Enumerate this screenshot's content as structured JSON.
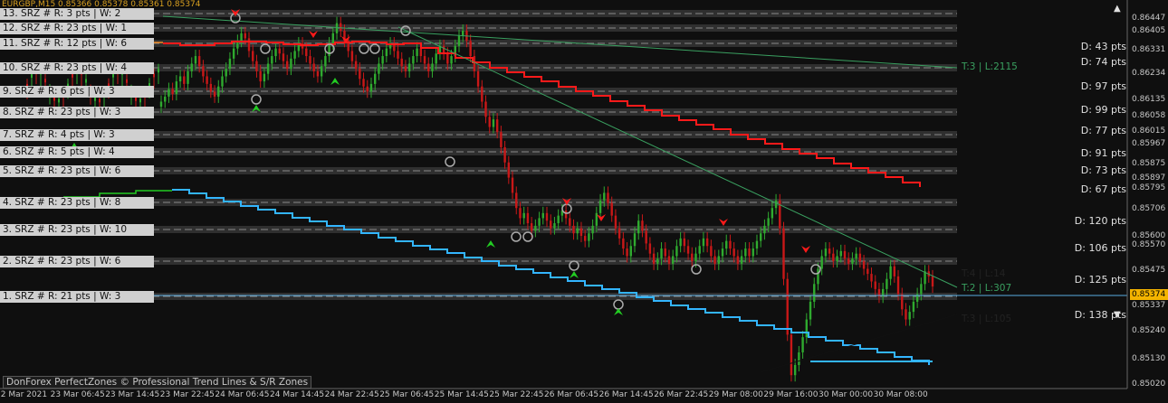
{
  "header": {
    "symbol_text": "EURGBP,M15  0.85366 0.85378 0.85361 0.85374"
  },
  "colors": {
    "background": "#0f0f0f",
    "bull": "#2faa2f",
    "bear": "#c81818",
    "resistance": "#ff1a1a",
    "support": "#33b5ff",
    "orange": "#f08a24",
    "green_band": "#22cc22",
    "zone": "#4a4a4a",
    "price_line": "#5aaee0",
    "current_price_bg": "#f4b400"
  },
  "zones": [
    {
      "label": "13. SRZ # R: 3 pts | W: 2",
      "distance": "",
      "price": 0.8644
    },
    {
      "label": "12. SRZ # R: 23 pts | W: 1",
      "distance": "D: 43 pts",
      "price": 0.864
    },
    {
      "label": "11. SRZ # R: 12 pts | W: 6",
      "distance": "D: 74 pts",
      "price": 0.8633
    },
    {
      "label": "10. SRZ # R: 23 pts | W: 4",
      "distance": "D: 97 pts",
      "price": 0.8623
    },
    {
      "label": "9. SRZ # R: 6 pts | W: 3",
      "distance": "D: 99 pts",
      "price": 0.8613
    },
    {
      "label": "8. SRZ # R: 23 pts | W: 3",
      "distance": "D: 77 pts",
      "price": 0.8606
    },
    {
      "label": "7. SRZ # R: 4 pts | W: 3",
      "distance": "D: 91 pts",
      "price": 0.8597
    },
    {
      "label": "6. SRZ # R: 5 pts | W: 4",
      "distance": "D: 73 pts",
      "price": 0.8589
    },
    {
      "label": "5. SRZ # R: 23 pts | W: 6",
      "distance": "D: 67 pts",
      "price": 0.8582
    },
    {
      "label": "4. SRZ # R: 23 pts | W: 8",
      "distance": "D: 120 pts",
      "price": 0.857
    },
    {
      "label": "3. SRZ # R: 23 pts | W: 10",
      "distance": "D: 106 pts",
      "price": 0.8558
    },
    {
      "label": "2. SRZ # R: 23 pts | W: 6",
      "distance": "D: 125 pts",
      "price": 0.8545
    },
    {
      "label": "1. SRZ # R: 21 pts | W: 3",
      "distance": "D: 138 pts",
      "price": 0.8534
    }
  ],
  "trendline_labels": [
    {
      "text": "T:3 | L:2115",
      "color": "#3aa060"
    },
    {
      "text": "T:4 | L:14",
      "color": "#222222"
    },
    {
      "text": "T:2 | L:307",
      "color": "#3aa060"
    },
    {
      "text": "T:3 | L:105",
      "color": "#222222"
    }
  ],
  "footer": "DonForex PerfectZones © Professional Trend Lines & S/R Zones",
  "current_price": "0.85374",
  "chart_data": {
    "type": "candlestick",
    "title": "EURGBP,M15",
    "ylim": [
      0.8501,
      0.8648
    ],
    "x_ticks": [
      "22 Mar 2021",
      "23 Mar 06:45",
      "23 Mar 14:45",
      "23 Mar 22:45",
      "24 Mar 06:45",
      "24 Mar 14:45",
      "24 Mar 22:45",
      "25 Mar 06:45",
      "25 Mar 14:45",
      "25 Mar 22:45",
      "26 Mar 06:45",
      "26 Mar 14:45",
      "26 Mar 22:45",
      "29 Mar 08:00",
      "29 Mar 16:00",
      "30 Mar 00:00",
      "30 Mar 08:00"
    ],
    "y_ticks": [
      "0.86447",
      "0.86405",
      "0.86331",
      "0.86234",
      "0.86135",
      "0.86058",
      "0.86015",
      "0.85967",
      "0.85875",
      "0.85897",
      "0.85795",
      "0.85706",
      "0.85600",
      "0.85570",
      "0.85475",
      "0.85337",
      "0.85240",
      "0.85130",
      "0.85020"
    ],
    "close": [
      0.861,
      0.8612,
      0.8615,
      0.8613,
      0.8618,
      0.862,
      0.8617,
      0.8622,
      0.8625,
      0.8628,
      0.8624,
      0.862,
      0.8617,
      0.8614,
      0.8612,
      0.8616,
      0.862,
      0.8623,
      0.8627,
      0.8631,
      0.8634,
      0.8637,
      0.8635,
      0.863,
      0.8626,
      0.8622,
      0.8618,
      0.8621,
      0.8625,
      0.8628,
      0.8631,
      0.8629,
      0.8626,
      0.8623,
      0.8627,
      0.863,
      0.8633,
      0.8631,
      0.8628,
      0.8625,
      0.8622,
      0.862,
      0.8624,
      0.8628,
      0.8633,
      0.8637,
      0.8641,
      0.8638,
      0.8634,
      0.863,
      0.8626,
      0.8623,
      0.8619,
      0.8616,
      0.8614,
      0.8617,
      0.8621,
      0.8625,
      0.8628,
      0.8631,
      0.8633,
      0.863,
      0.8627,
      0.8624,
      0.8622,
      0.8625,
      0.8628,
      0.8631,
      0.8628,
      0.8625,
      0.8622,
      0.8625,
      0.8629,
      0.8632,
      0.8629,
      0.8625,
      0.8628,
      0.8632,
      0.8636,
      0.8638,
      0.8634,
      0.8628,
      0.8622,
      0.8616,
      0.861,
      0.8604,
      0.86,
      0.8603,
      0.8598,
      0.8592,
      0.8586,
      0.858,
      0.8574,
      0.8568,
      0.8564,
      0.8566,
      0.8562,
      0.8559,
      0.8561,
      0.8564,
      0.8566,
      0.8563,
      0.856,
      0.8562,
      0.8565,
      0.8567,
      0.8564,
      0.8561,
      0.8558,
      0.856,
      0.8557,
      0.8555,
      0.8558,
      0.8561,
      0.8566,
      0.8571,
      0.8574,
      0.857,
      0.8565,
      0.856,
      0.8556,
      0.8552,
      0.8549,
      0.8553,
      0.8558,
      0.8563,
      0.8559,
      0.8554,
      0.855,
      0.8546,
      0.8548,
      0.8552,
      0.8549,
      0.8546,
      0.8549,
      0.8553,
      0.8556,
      0.8553,
      0.855,
      0.8547,
      0.855,
      0.8553,
      0.8556,
      0.8553,
      0.8549,
      0.8546,
      0.8549,
      0.8552,
      0.8555,
      0.8552,
      0.8549,
      0.8546,
      0.8549,
      0.8552,
      0.8549,
      0.8552,
      0.8555,
      0.8558,
      0.8561,
      0.8564,
      0.8568,
      0.8571,
      0.856,
      0.854,
      0.8518,
      0.8502,
      0.8506,
      0.8511,
      0.8517,
      0.8524,
      0.8531,
      0.8538,
      0.8544,
      0.8549,
      0.8552,
      0.855,
      0.8547,
      0.8549,
      0.8551,
      0.8548,
      0.8546,
      0.8548,
      0.855,
      0.8547,
      0.8544,
      0.8542,
      0.8539,
      0.8536,
      0.8533,
      0.8536,
      0.854,
      0.8545,
      0.8541,
      0.8534,
      0.8528,
      0.8524,
      0.8527,
      0.8531,
      0.8534,
      0.8538,
      0.8543,
      0.8541,
      0.8537
    ]
  }
}
